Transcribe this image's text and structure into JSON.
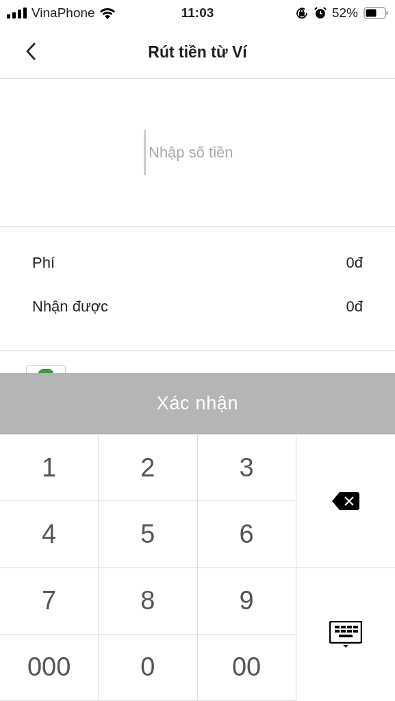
{
  "status_bar": {
    "carrier": "VinaPhone",
    "time": "11:03",
    "battery": "52%"
  },
  "header": {
    "title": "Rút tiền từ Ví"
  },
  "amount": {
    "placeholder": "Nhập số tiền"
  },
  "summary": [
    {
      "label": "Phí",
      "value": "0đ"
    },
    {
      "label": "Nhận được",
      "value": "0đ"
    }
  ],
  "confirm_button": {
    "label": "Xác nhận",
    "disabled": true
  },
  "keypad": {
    "keys": [
      "1",
      "2",
      "3",
      "4",
      "5",
      "6",
      "7",
      "8",
      "9",
      "000",
      "0",
      "00"
    ]
  }
}
